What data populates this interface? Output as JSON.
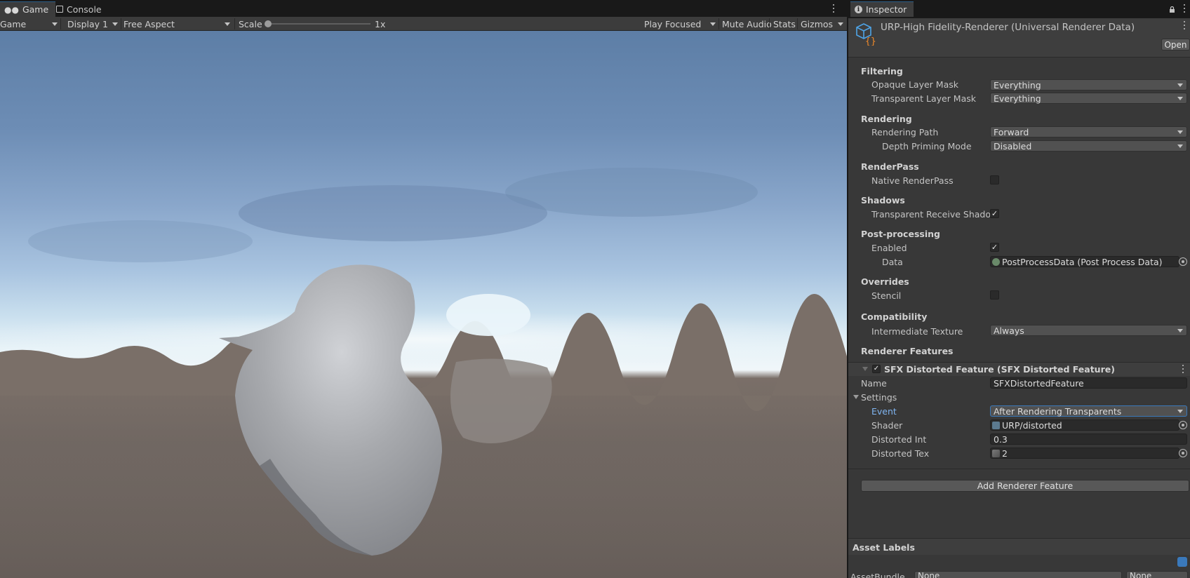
{
  "game_panel": {
    "tabs": [
      {
        "label": "Game",
        "icon": "gamepad-icon"
      },
      {
        "label": "Console",
        "icon": "console-icon"
      }
    ],
    "toolbar": {
      "mode": "Game",
      "display": "Display 1",
      "aspect": "Free Aspect",
      "scale_label": "Scale",
      "scale_value": "1x",
      "play_mode": "Play Focused",
      "mute_audio": "Mute Audio",
      "stats": "Stats",
      "gizmos": "Gizmos"
    }
  },
  "inspector": {
    "tab": {
      "label": "Inspector",
      "icon": "info-icon"
    },
    "asset": {
      "title": "URP-High Fidelity-Renderer (Universal Renderer Data)",
      "icon": "renderer-data-icon",
      "open_label": "Open"
    },
    "filtering": {
      "title": "Filtering",
      "opaque_label": "Opaque Layer Mask",
      "opaque_value": "Everything",
      "transparent_label": "Transparent Layer Mask",
      "transparent_value": "Everything"
    },
    "rendering": {
      "title": "Rendering",
      "path_label": "Rendering Path",
      "path_value": "Forward",
      "depth_label": "Depth Priming Mode",
      "depth_value": "Disabled"
    },
    "renderpass": {
      "title": "RenderPass",
      "native_label": "Native RenderPass",
      "native_checked": false
    },
    "shadows": {
      "title": "Shadows",
      "transparent_label": "Transparent Receive Shadow",
      "transparent_checked": true
    },
    "post_processing": {
      "title": "Post-processing",
      "enabled_label": "Enabled",
      "enabled_checked": true,
      "data_label": "Data",
      "data_value": "PostProcessData (Post Process Data)"
    },
    "overrides": {
      "title": "Overrides",
      "stencil_label": "Stencil",
      "stencil_checked": false
    },
    "compatibility": {
      "title": "Compatibility",
      "intermediate_label": "Intermediate Texture",
      "intermediate_value": "Always"
    },
    "renderer_features": {
      "title": "Renderer Features",
      "feature_title": "SFX Distorted Feature (SFX Distorted Feature)",
      "feature_enabled": true,
      "name_label": "Name",
      "name_value": "SFXDistortedFeature",
      "settings_label": "Settings",
      "event_label": "Event",
      "event_value": "After Rendering Transparents",
      "shader_label": "Shader",
      "shader_value": "URP/distorted",
      "int_label": "Distorted Int",
      "int_value": "0.3",
      "tex_label": "Distorted Tex",
      "tex_value": "2",
      "add_label": "Add Renderer Feature"
    },
    "asset_labels": {
      "title": "Asset Labels",
      "assetbundle_label": "AssetBundle",
      "assetbundle_value": "None",
      "variant_value": "None"
    }
  },
  "colors": {
    "accent": "#3a79bb",
    "active_label": "#7fb4f0",
    "panel_bg": "#383838"
  }
}
